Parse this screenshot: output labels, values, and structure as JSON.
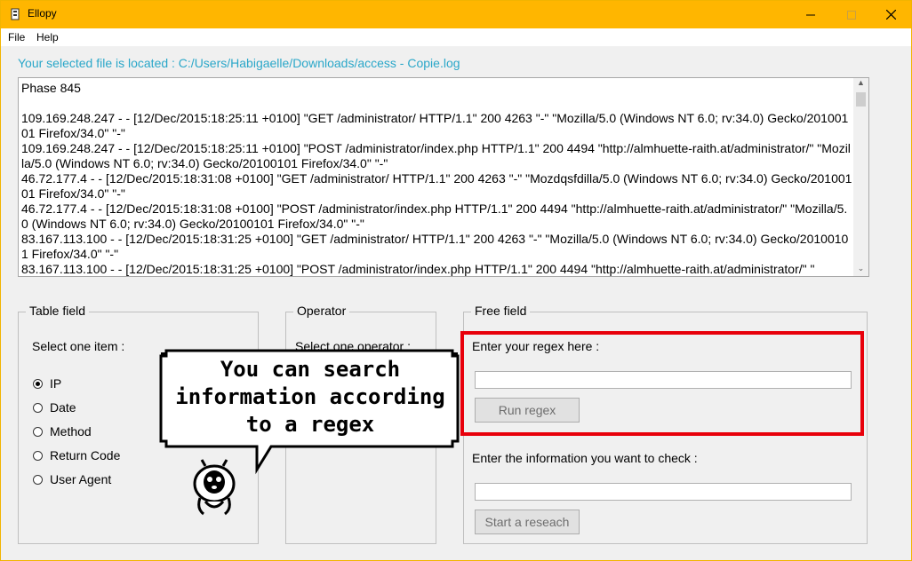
{
  "window": {
    "title": "Ellopy",
    "title_bar_color": "#ffb600"
  },
  "menu": {
    "items": [
      "File",
      "Help"
    ]
  },
  "file_path_text": "Your selected file is located : C:/Users/Habigaelle/Downloads/access - Copie.log",
  "log": {
    "text": "Phase 845\n\n109.169.248.247 - - [12/Dec/2015:18:25:11 +0100] \"GET /administrator/ HTTP/1.1\" 200 4263 \"-\" \"Mozilla/5.0 (Windows NT 6.0; rv:34.0) Gecko/20100101 Firefox/34.0\" \"-\"\n109.169.248.247 - - [12/Dec/2015:18:25:11 +0100] \"POST /administrator/index.php HTTP/1.1\" 200 4494 \"http://almhuette-raith.at/administrator/\" \"Mozilla/5.0 (Windows NT 6.0; rv:34.0) Gecko/20100101 Firefox/34.0\" \"-\"\n46.72.177.4 - - [12/Dec/2015:18:31:08 +0100] \"GET /administrator/ HTTP/1.1\" 200 4263 \"-\" \"Mozdqsfdilla/5.0 (Windows NT 6.0; rv:34.0) Gecko/20100101 Firefox/34.0\" \"-\"\n46.72.177.4 - - [12/Dec/2015:18:31:08 +0100] \"POST /administrator/index.php HTTP/1.1\" 200 4494 \"http://almhuette-raith.at/administrator/\" \"Mozilla/5.0 (Windows NT 6.0; rv:34.0) Gecko/20100101 Firefox/34.0\" \"-\"\n83.167.113.100 - - [12/Dec/2015:18:31:25 +0100] \"GET /administrator/ HTTP/1.1\" 200 4263 \"-\" \"Mozilla/5.0 (Windows NT 6.0; rv:34.0) Gecko/20100101 Firefox/34.0\" \"-\"\n83.167.113.100 - - [12/Dec/2015:18:31:25 +0100] \"POST /administrator/index.php HTTP/1.1\" 200 4494 \"http://almhuette-raith.at/administrator/\" \""
  },
  "table_field": {
    "title": "Table field",
    "prompt": "Select one item :",
    "options": [
      "IP",
      "Date",
      "Method",
      "Return Code",
      "User Agent"
    ],
    "selected": "IP"
  },
  "operator": {
    "title": "Operator",
    "prompt": "Select one operator :"
  },
  "free_field": {
    "title": "Free field",
    "regex_label": "Enter your regex here :",
    "regex_value": "",
    "run_regex_button": "Run regex",
    "check_label": "Enter the information you want to check :",
    "check_value": "",
    "start_button": "Start a reseach"
  },
  "callout": {
    "text": "You can search information according to a regex"
  },
  "colors": {
    "accent_text": "#2aa7c9",
    "highlight": "#e8000b"
  }
}
